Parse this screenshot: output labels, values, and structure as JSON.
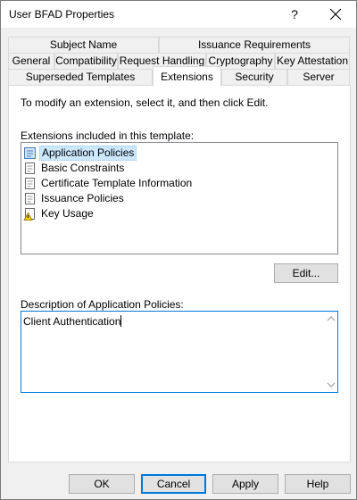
{
  "window": {
    "title": "User BFAD Properties",
    "help_glyph": "?"
  },
  "tabs": {
    "row_top": [
      "Subject Name",
      "Issuance Requirements"
    ],
    "row_middle": [
      "General",
      "Compatibility",
      "Request Handling",
      "Cryptography",
      "Key Attestation"
    ],
    "row_bottom": [
      "Superseded Templates",
      "Extensions",
      "Security",
      "Server"
    ],
    "selected": "Extensions"
  },
  "extensions_page": {
    "instruction": "To modify an extension, select it, and then click Edit.",
    "list_label": "Extensions included in this template:",
    "items": [
      {
        "label": "Application Policies",
        "icon": "policy-icon",
        "selected": true
      },
      {
        "label": "Basic Constraints",
        "icon": "document-icon",
        "selected": false
      },
      {
        "label": "Certificate Template Information",
        "icon": "document-icon",
        "selected": false
      },
      {
        "label": "Issuance Policies",
        "icon": "document-icon",
        "selected": false
      },
      {
        "label": "Key Usage",
        "icon": "key-warning-icon",
        "selected": false
      }
    ],
    "edit_button": "Edit...",
    "description_label": "Description of Application Policies:",
    "description_value": "Client Authentication"
  },
  "buttons": {
    "ok": "OK",
    "cancel": "Cancel",
    "apply": "Apply",
    "help": "Help"
  }
}
